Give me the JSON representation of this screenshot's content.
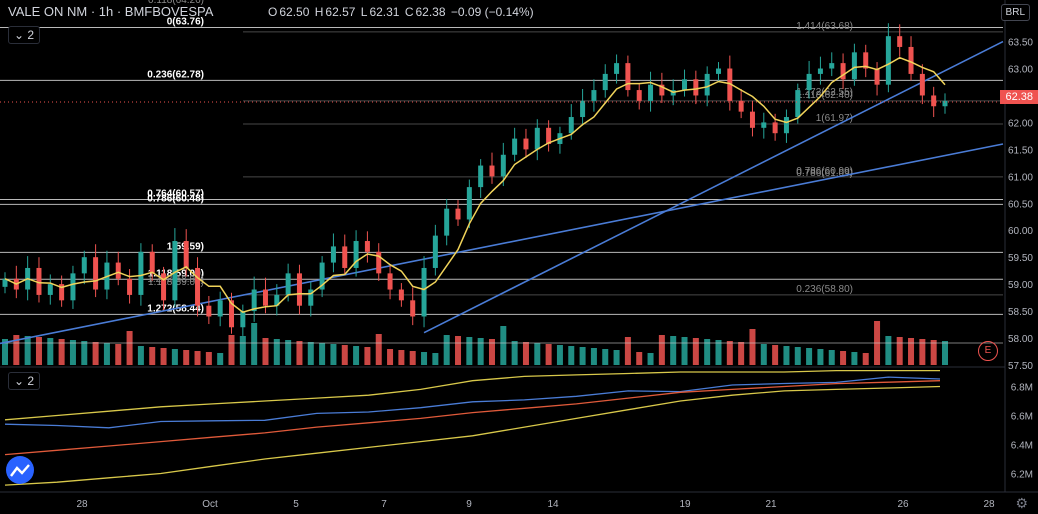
{
  "header": {
    "symbol": "VALE ON NM · 1h · BMFBOVESPA",
    "open_label": "O",
    "open": "62.50",
    "high_label": "H",
    "high": "62.57",
    "low_label": "L",
    "low": "62.31",
    "close_label": "C",
    "close": "62.38",
    "change": "−0.09 (−0.14%)"
  },
  "pane_toggle_main": "2",
  "pane_toggle_lower": "2",
  "currency": "BRL",
  "last_price_tag": "62.38",
  "event_marker": "E",
  "colors": {
    "up": "#26a69a",
    "down": "#ef5350",
    "bg": "#000000",
    "ma": "#f0d35a",
    "trend": "#4a7cd6",
    "fib": "#cfcfcf"
  },
  "icons": [
    "chevron-down-icon",
    "settings-gear-icon",
    "tradingview-logo-icon",
    "earnings-event-icon"
  ],
  "chart_data": [
    {
      "type": "candlestick",
      "title": "",
      "x_ticks": [
        "28",
        "Oct",
        "5",
        "7",
        "9",
        "14",
        "19",
        "21",
        "26",
        "28"
      ],
      "ylim": [
        57.5,
        63.9
      ],
      "y_ticks": [
        63.5,
        63.0,
        62.5,
        62.0,
        61.5,
        61.0,
        60.5,
        60.0,
        59.5,
        59.0,
        58.5,
        58.0,
        57.5
      ],
      "close_path": [
        59.1,
        58.9,
        59.3,
        58.8,
        59.0,
        58.7,
        59.2,
        59.5,
        58.9,
        59.4,
        59.1,
        58.8,
        59.6,
        59.2,
        58.7,
        59.8,
        59.3,
        58.6,
        58.4,
        58.7,
        58.2,
        58.5,
        58.9,
        58.6,
        58.8,
        59.2,
        58.6,
        58.9,
        59.4,
        59.7,
        59.3,
        59.8,
        59.6,
        59.2,
        58.9,
        58.7,
        58.4,
        59.3,
        59.9,
        60.4,
        60.2,
        60.8,
        61.2,
        61.0,
        61.4,
        61.7,
        61.5,
        61.9,
        61.6,
        61.8,
        62.1,
        62.4,
        62.6,
        62.9,
        63.1,
        62.6,
        62.4,
        62.7,
        62.5,
        62.6,
        62.8,
        62.5,
        62.9,
        63.0,
        62.4,
        62.2,
        61.9,
        62.0,
        61.8,
        62.1,
        62.6,
        62.9,
        63.0,
        63.1,
        62.8,
        63.3,
        63.0,
        62.7,
        63.6,
        63.4,
        62.9,
        62.5,
        62.3,
        62.4
      ],
      "fib_levels": [
        {
          "label": "0(63.76)",
          "value": 63.76
        },
        {
          "label": "0.236(62.78)",
          "value": 62.78
        },
        {
          "label": "0.764(60.57)",
          "value": 60.57
        },
        {
          "label": "0.786(60.48)",
          "value": 60.48
        },
        {
          "label": "1(59.59)",
          "value": 59.59
        },
        {
          "label": "1.118(59.09)",
          "value": 59.09
        },
        {
          "label": "1.272(58.44)",
          "value": 58.44
        },
        {
          "label": "1.414(63.68)",
          "value": 63.68
        },
        {
          "label": "1.118(62.40)",
          "value": 62.4
        },
        {
          "label": "1(61.97)",
          "value": 61.97
        },
        {
          "label": "0.786(60.99)",
          "value": 60.99
        },
        {
          "label": "0.236(58.80)",
          "value": 58.8
        }
      ],
      "annotations": [
        "0.118(64.26)",
        "1.272(62.55)",
        "0.786(61.09)",
        "1.118(59.09)",
        "1.272(58.94)"
      ],
      "trendlines": [
        {
          "from": [
            0,
            57.9
          ],
          "to": [
            84,
            61.6
          ]
        },
        {
          "from": [
            37,
            58.1
          ],
          "to": [
            84,
            63.5
          ]
        }
      ]
    },
    {
      "type": "line",
      "title": "",
      "ylim": [
        6.1,
        6.9
      ],
      "y_ticks": [
        6.8,
        6.6,
        6.4,
        6.2
      ],
      "y_tick_labels": [
        "6.8M",
        "6.6M",
        "6.4M",
        "6.2M"
      ],
      "series": [
        {
          "values": [
            6.54,
            6.52,
            6.53,
            6.55,
            6.56,
            6.58,
            6.6,
            6.63,
            6.66,
            6.68,
            6.72,
            6.73,
            6.76,
            6.78,
            6.8,
            6.82,
            6.84,
            6.85,
            6.86
          ]
        },
        {
          "values": [
            6.33,
            6.36,
            6.39,
            6.42,
            6.45,
            6.48,
            6.52,
            6.55,
            6.58,
            6.62,
            6.65,
            6.68,
            6.72,
            6.76,
            6.78,
            6.8,
            6.82,
            6.83,
            6.84
          ]
        },
        {
          "values": [
            6.57,
            6.6,
            6.63,
            6.66,
            6.68,
            6.7,
            6.72,
            6.74,
            6.78,
            6.84,
            6.87,
            6.88,
            6.89,
            6.9,
            6.9,
            6.9,
            6.91,
            6.91,
            6.91
          ]
        },
        {
          "values": [
            6.12,
            6.14,
            6.17,
            6.2,
            6.25,
            6.3,
            6.34,
            6.38,
            6.42,
            6.46,
            6.52,
            6.58,
            6.64,
            6.7,
            6.74,
            6.77,
            6.78,
            6.79,
            6.8
          ]
        }
      ]
    }
  ]
}
